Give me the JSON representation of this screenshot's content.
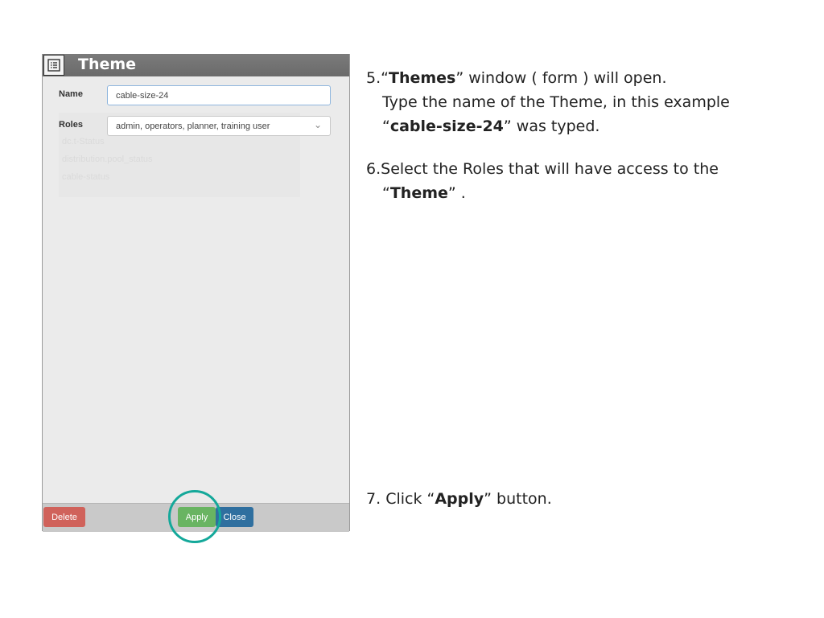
{
  "window": {
    "title": "Theme",
    "icon": "list-icon"
  },
  "form": {
    "name_label": "Name",
    "name_value": "cable-size-24",
    "roles_label": "Roles",
    "roles_value": "admin, operators, planner, training user",
    "roles_chevron": "⌄",
    "faded_list": [
      "dc.t-Status",
      "distribution.pool_status",
      "cable-status"
    ]
  },
  "footer": {
    "delete_label": "Delete",
    "apply_label": "Apply",
    "close_label": "Close"
  },
  "colors": {
    "delete": "#d0625b",
    "apply": "#69b462",
    "close": "#2f6f9f",
    "highlight": "#14a89a",
    "titlebar": "#6e6e6e"
  },
  "instructions": {
    "step5": {
      "num": "5.",
      "q1": "“",
      "b1": "Themes",
      "t1": "” window ( form ) will open.",
      "line2": "Type the name of the Theme, in this example",
      "q2": "“",
      "b2": "cable-size-24",
      "t2": "” was typed."
    },
    "step6": {
      "num": "6.",
      "line1": "Select the Roles that will have access to the",
      "q1": "“",
      "b1": "Theme",
      "t1": "” ."
    },
    "step7": {
      "num": "7.",
      "t0": "Click “",
      "b1": "Apply",
      "t1": "” button."
    }
  }
}
